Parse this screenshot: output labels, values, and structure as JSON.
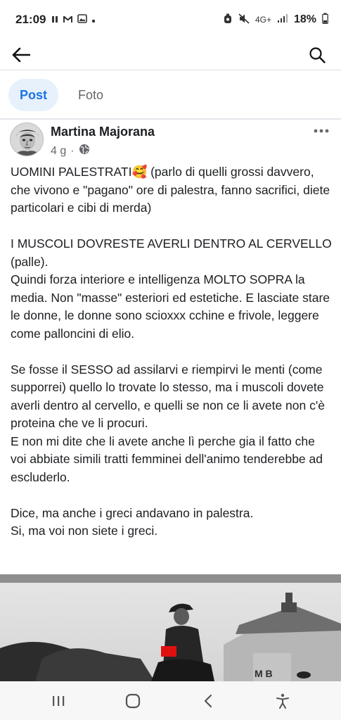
{
  "status_bar": {
    "time": "21:09",
    "left_icons": [
      "pause-icon",
      "gmail-icon",
      "gallery-icon",
      "dot-icon"
    ],
    "network": "4G+",
    "battery": "18%"
  },
  "app_bar": {
    "back_icon": "arrow-left-icon",
    "search_icon": "search-icon"
  },
  "tabs": [
    {
      "label": "Post",
      "active": true
    },
    {
      "label": "Foto",
      "active": false
    }
  ],
  "post": {
    "author": "Martina Majorana",
    "time": "4 g",
    "privacy_icon": "globe-icon",
    "emoji": "🥰",
    "paragraph_1_before_emoji": "UOMINI PALESTRATI",
    "paragraph_1_after_emoji": " (parlo di quelli grossi davvero, che vivono e \"pagano\" ore di palestra, fanno sacrifici, diete particolari e cibi di merda)",
    "paragraph_2": "I MUSCOLI DOVRESTE AVERLI DENTRO AL CERVELLO (palle).\nQuindi forza interiore e intelligenza MOLTO SOPRA la media. Non \"masse\" esteriori ed estetiche. E lasciate stare le donne, le donne sono scioxxx cchine e frivole, leggere come palloncini di elio.",
    "paragraph_3": "Se fosse il SESSO ad assilarvi e riempirvi le menti (come supporrei) quello lo trovate lo stesso, ma i muscoli dovete averli dentro al cervello, e quelli se non ce li avete non c'è proteina che ve li procuri.\nE non mi dite che li avete anche lì perche gia il fatto che voi abbiate simili tratti femminei dell'animo tenderebbe ad escluderlo.",
    "paragraph_4": "Dice, ma anche i greci andavano in palestra.\nSi, ma voi non siete i greci.",
    "photo_sign_text": "M B"
  },
  "nav_bar": {
    "buttons": [
      "recent-apps-icon",
      "home-icon",
      "back-icon",
      "accessibility-icon"
    ]
  },
  "colors": {
    "accent": "#1b74e4",
    "tab_active_bg": "#e7f1fb",
    "text": "#1c1e21",
    "secondary": "#65676b"
  }
}
